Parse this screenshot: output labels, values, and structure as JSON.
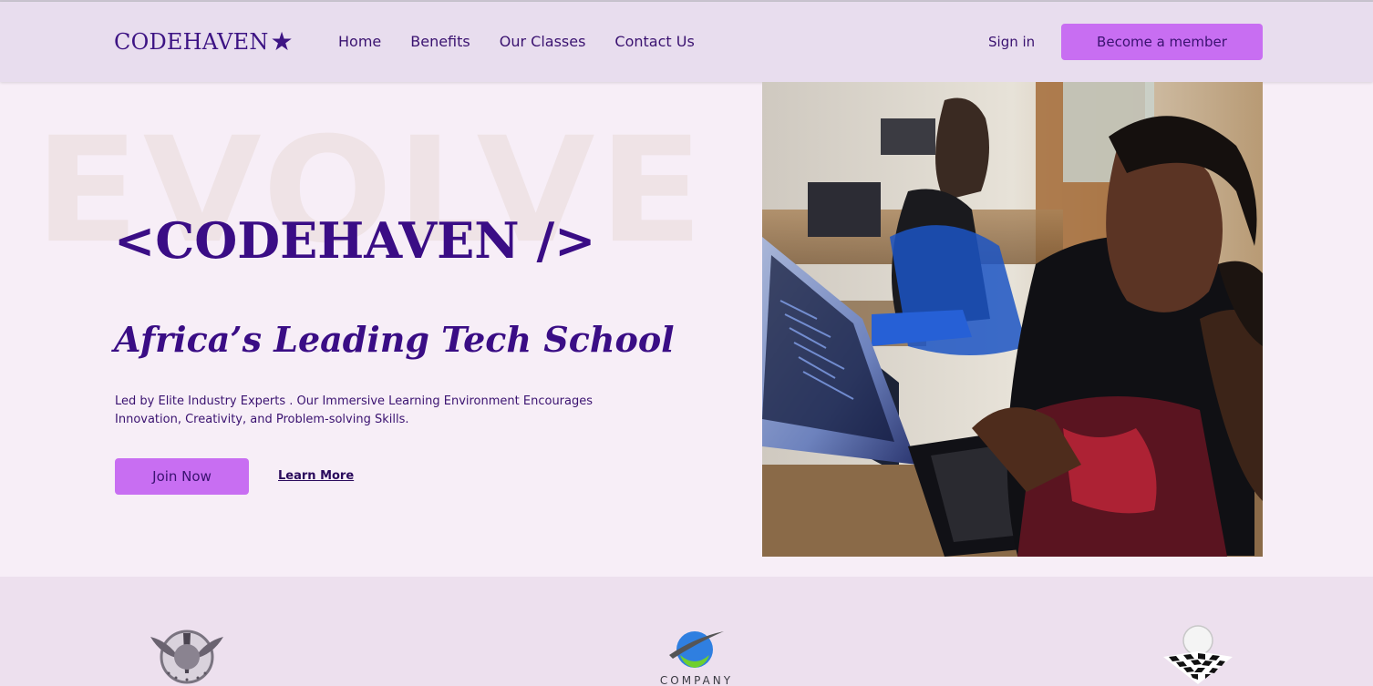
{
  "brand": {
    "name": "CODEHAVEN",
    "star_icon": "star-icon"
  },
  "nav": {
    "links": [
      "Home",
      "Benefits",
      "Our Classes",
      "Contact Us"
    ],
    "sign_in": "Sign in",
    "member_button": "Become a member"
  },
  "hero": {
    "background_word": "EVOLVE",
    "title": "<CODEHAVEN />",
    "subtitle": "Africa’s Leading Tech School",
    "description": "Led by Elite Industry Experts . Our Immersive Learning Environment Encourages Innovation, Creativity, and Problem-solving Skills.",
    "join_button": "Join Now",
    "learn_more": "Learn More",
    "image": "photo of students coding on laptops"
  },
  "partners": {
    "logos": [
      "winged-emblem-logo",
      "globe-company-logo",
      "checkered-ball-logo"
    ],
    "company_label": "COMPANY"
  },
  "colors": {
    "accent": "#c86ef2",
    "brand_purple": "#3a0d85",
    "page_bg": "#f7eef7",
    "nav_bg": "#e8ddee"
  }
}
